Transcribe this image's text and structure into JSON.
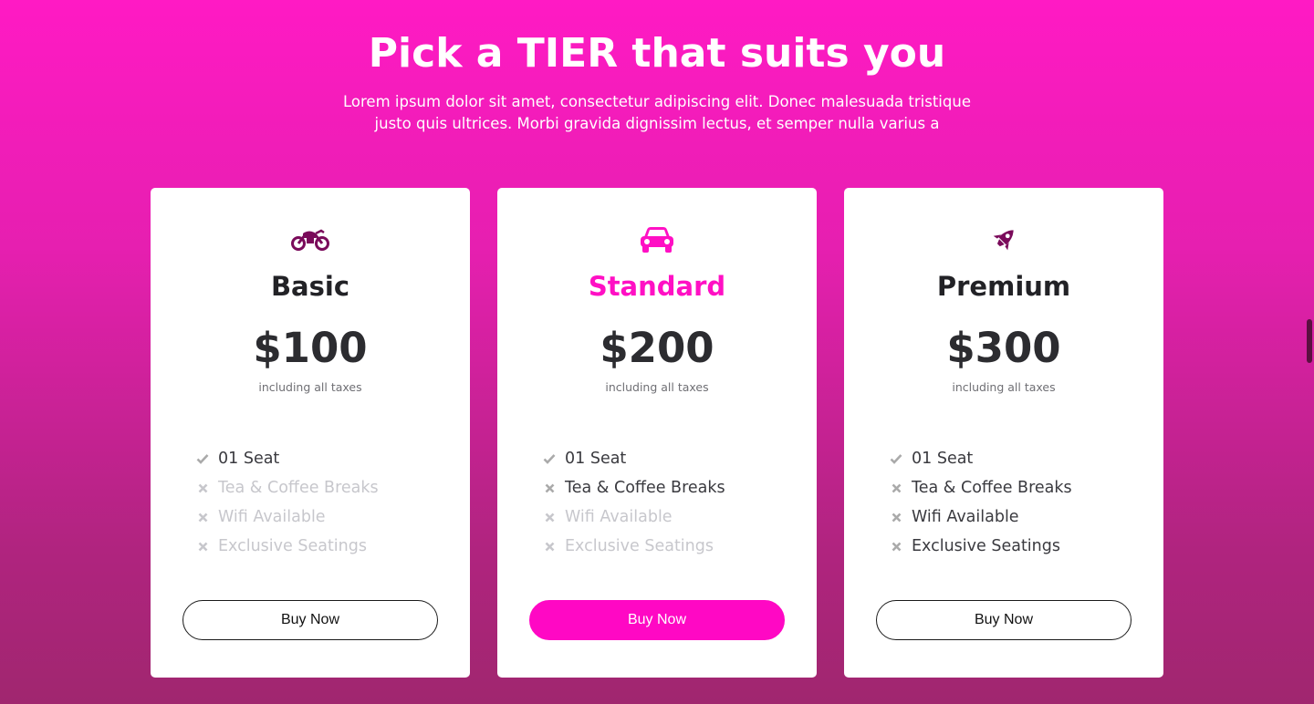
{
  "header": {
    "title": "Pick a TIER that suits you",
    "subtitle": "Lorem ipsum dolor sit amet, consectetur adipiscing elit. Donec malesuada tristique justo quis ultrices. Morbi gravida dignissim lectus, et semper nulla varius a"
  },
  "colors": {
    "accent": "#ff08c4",
    "icon_dark": "#7a0a5a",
    "check": "#aaaaaa",
    "cross": "#c7c7cc"
  },
  "tiers": [
    {
      "icon": "motorcycle-icon",
      "name": "Basic",
      "price": "$100",
      "tax_note": "including all taxes",
      "features": [
        {
          "label": "01 Seat",
          "included": true
        },
        {
          "label": "Tea & Coffee Breaks",
          "included": false
        },
        {
          "label": "Wifi Available",
          "included": false
        },
        {
          "label": "Exclusive Seatings",
          "included": false
        }
      ],
      "button": "Buy Now"
    },
    {
      "icon": "car-icon",
      "name": "Standard",
      "price": "$200",
      "tax_note": "including all taxes",
      "features": [
        {
          "label": "01 Seat",
          "included": true
        },
        {
          "label": "Tea & Coffee Breaks",
          "included": true
        },
        {
          "label": "Wifi Available",
          "included": false
        },
        {
          "label": "Exclusive Seatings",
          "included": false
        }
      ],
      "button": "Buy Now"
    },
    {
      "icon": "rocket-icon",
      "name": "Premium",
      "price": "$300",
      "tax_note": "including all taxes",
      "features": [
        {
          "label": "01 Seat",
          "included": true
        },
        {
          "label": "Tea & Coffee Breaks",
          "included": true
        },
        {
          "label": "Wifi Available",
          "included": true
        },
        {
          "label": "Exclusive Seatings",
          "included": true
        }
      ],
      "button": "Buy Now"
    }
  ]
}
